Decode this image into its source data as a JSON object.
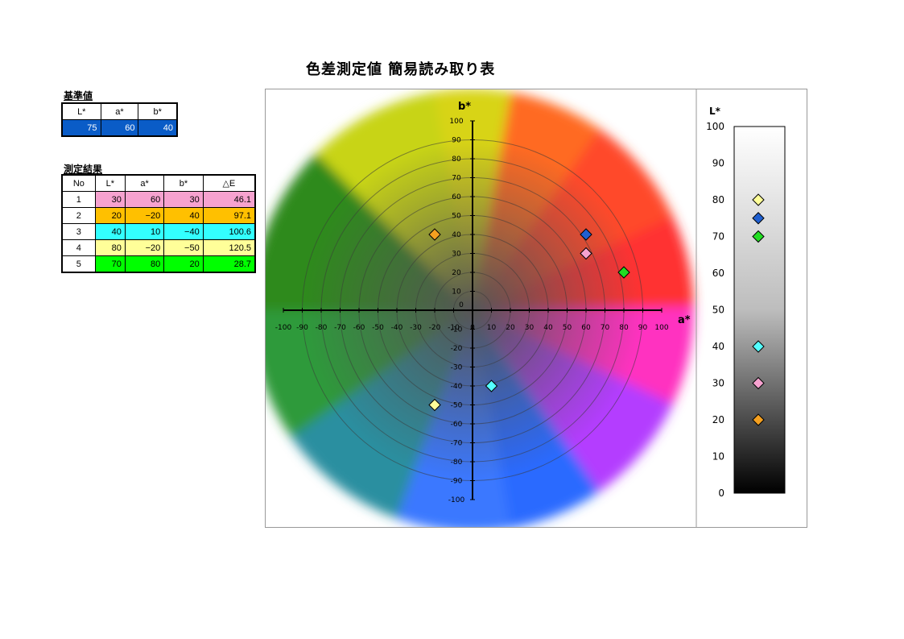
{
  "title": "色差測定値 簡易読み取り表",
  "reference": {
    "label": "基準値",
    "headers": [
      "L*",
      "a*",
      "b*"
    ],
    "values": [
      75,
      60,
      40
    ],
    "color": "#0a5cc7"
  },
  "results": {
    "label": "測定結果",
    "headers": [
      "No",
      "L*",
      "a*",
      "b*",
      "△E"
    ],
    "rows": [
      {
        "no": "1",
        "L": "30",
        "a": "60",
        "b": "30",
        "dE": "46.1",
        "color": "#f6a2cf"
      },
      {
        "no": "2",
        "L": "20",
        "a": "−20",
        "b": "40",
        "dE": "97.1",
        "color": "#ffc000"
      },
      {
        "no": "3",
        "L": "40",
        "a": "10",
        "b": "−40",
        "dE": "100.6",
        "color": "#33ffff"
      },
      {
        "no": "4",
        "L": "80",
        "a": "−20",
        "b": "−50",
        "dE": "120.5",
        "color": "#ffff99"
      },
      {
        "no": "5",
        "L": "70",
        "a": "80",
        "b": "20",
        "dE": "28.7",
        "color": "#00ff00"
      }
    ]
  },
  "chart_data": [
    {
      "type": "scatter",
      "xlabel": "a*",
      "ylabel": "b*",
      "xlim": [
        -100,
        100
      ],
      "ylim": [
        -100,
        100
      ],
      "xticks": [
        -100,
        -90,
        -80,
        -70,
        -60,
        -50,
        -40,
        -30,
        -20,
        -10,
        0,
        10,
        20,
        30,
        40,
        50,
        60,
        70,
        80,
        90,
        100
      ],
      "yticks": [
        -100,
        -90,
        -80,
        -70,
        -60,
        -50,
        -40,
        -30,
        -20,
        -10,
        0,
        10,
        20,
        30,
        40,
        50,
        60,
        70,
        80,
        90,
        100
      ],
      "rings": [
        10,
        20,
        30,
        40,
        50,
        60,
        70,
        80,
        90
      ],
      "points": [
        {
          "no": "基準",
          "a": 60,
          "b": 40,
          "color": "#1f5fd0"
        },
        {
          "no": "1",
          "a": 60,
          "b": 30,
          "color": "#f6a2cf"
        },
        {
          "no": "2",
          "a": -20,
          "b": 40,
          "color": "#f4a020"
        },
        {
          "no": "3",
          "a": 10,
          "b": -40,
          "color": "#55ffff"
        },
        {
          "no": "4",
          "a": -20,
          "b": -50,
          "color": "#ffff99"
        },
        {
          "no": "5",
          "a": 80,
          "b": 20,
          "color": "#22dd22"
        }
      ]
    },
    {
      "type": "scatter",
      "ylabel": "L*",
      "ylim": [
        0,
        100
      ],
      "yticks": [
        0,
        10,
        20,
        30,
        40,
        50,
        60,
        70,
        80,
        90,
        100
      ],
      "points": [
        {
          "no": "4",
          "L": 80,
          "color": "#ffff99"
        },
        {
          "no": "基準",
          "L": 75,
          "color": "#1f5fd0"
        },
        {
          "no": "5",
          "L": 70,
          "color": "#22dd22"
        },
        {
          "no": "3",
          "L": 40,
          "color": "#55ffff"
        },
        {
          "no": "1",
          "L": 30,
          "color": "#f6a2cf"
        },
        {
          "no": "2",
          "L": 20,
          "color": "#f4a020"
        }
      ]
    }
  ]
}
